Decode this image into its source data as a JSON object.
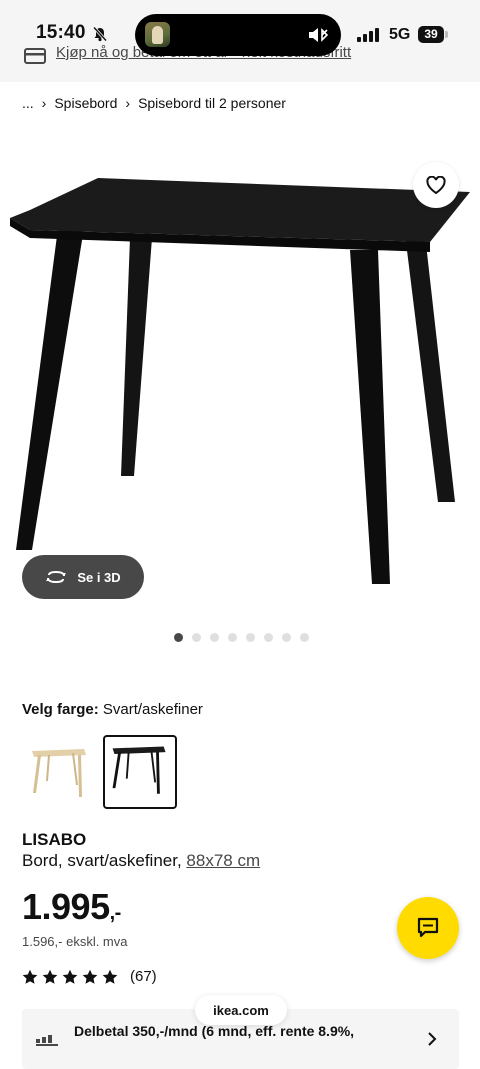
{
  "status": {
    "time": "15:40",
    "network": "5G",
    "battery": "39"
  },
  "promo": {
    "text": "Kjøp nå og betal om ett år - helt kostnadsfritt",
    "icon": "card-icon"
  },
  "breadcrumb": {
    "ellipsis": "...",
    "items": [
      "Spisebord",
      "Spisebord til 2 personer"
    ]
  },
  "gallery": {
    "view3d_label": "Se i 3D",
    "dots_total": 8,
    "active_dot": 0
  },
  "color": {
    "label": "Velg farge:",
    "value": "Svart/askefiner",
    "options": [
      "Bjørk",
      "Svart/askefiner"
    ],
    "selected_index": 1
  },
  "product": {
    "name": "LISABO",
    "description": "Bord, svart/askefiner,",
    "dimensions": "88x78 cm"
  },
  "price": {
    "main": "1.995",
    "suffix": ",-",
    "ex_vat": "1.596,- ekskl. mva"
  },
  "rating": {
    "stars": 5,
    "count": "(67)"
  },
  "browser": {
    "url": "ikea.com"
  },
  "finance": {
    "text": "Delbetal 350,-/mnd (6 mnd, eff. rente 8.9%,"
  },
  "colors": {
    "accent_yellow": "#ffdb00",
    "dark_button": "#484848",
    "background": "#ffffff"
  }
}
